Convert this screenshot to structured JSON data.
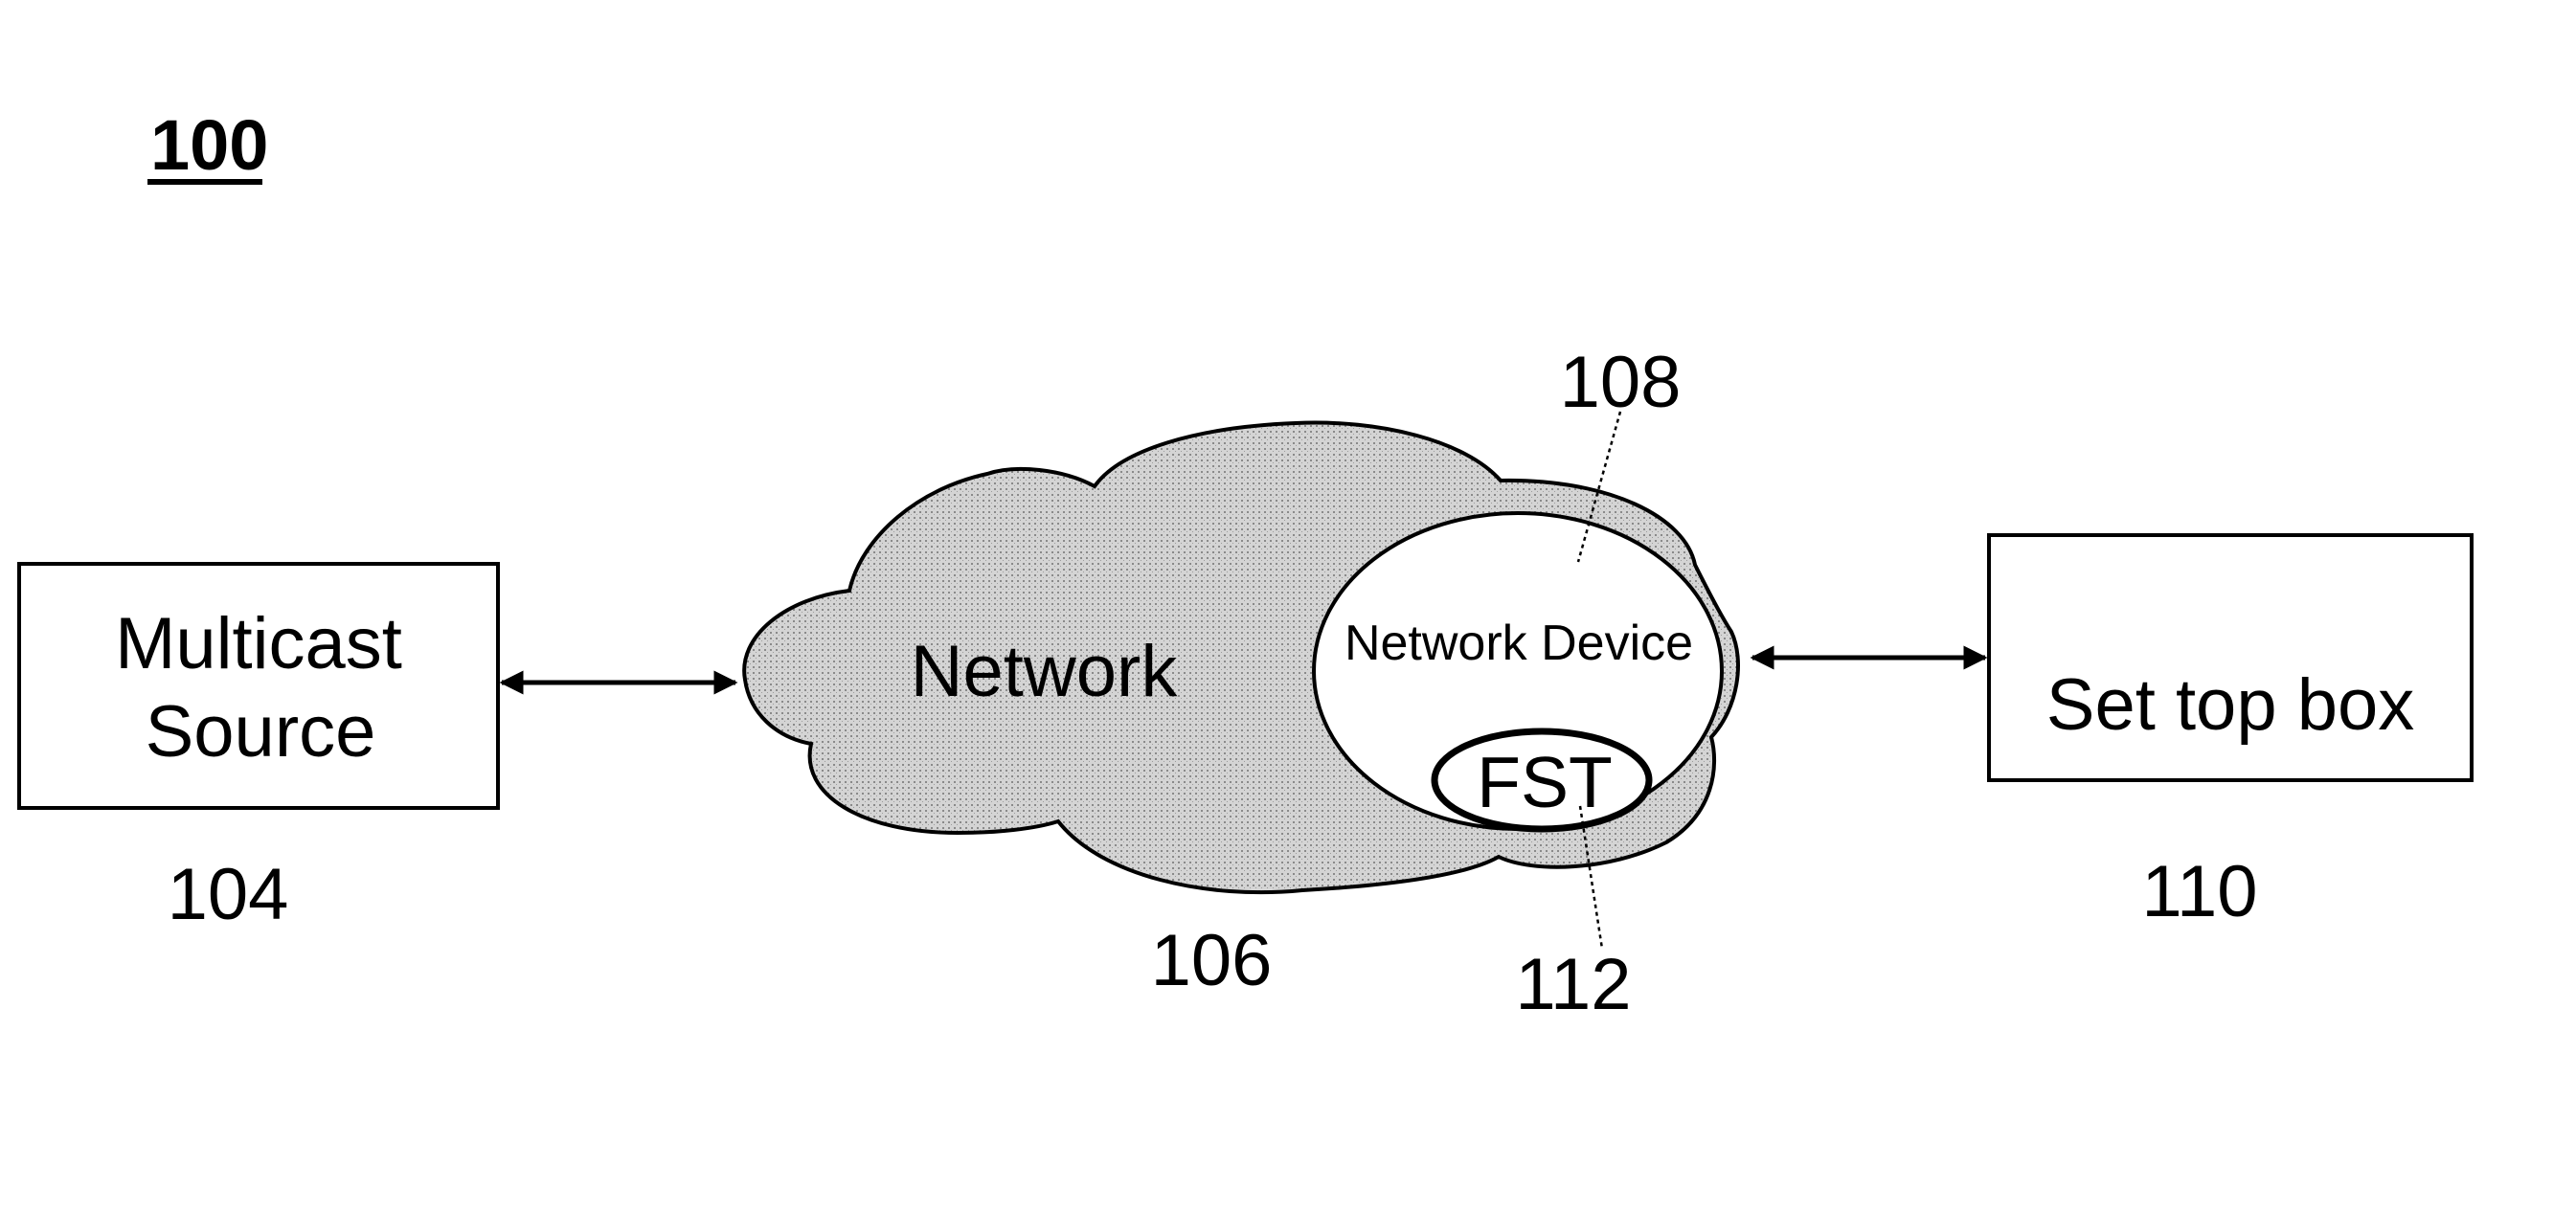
{
  "figure": {
    "number": "100"
  },
  "nodes": {
    "multicast_source": {
      "label_lines": [
        "Multicast",
        "Source"
      ],
      "ref": "104"
    },
    "network": {
      "label": "Network",
      "ref": "106"
    },
    "network_device": {
      "label": "Network Device",
      "ref": "108"
    },
    "set_top_box": {
      "label": "Set top box",
      "ref": "110"
    },
    "fst": {
      "label": "FST",
      "ref": "112"
    }
  },
  "connections": [
    {
      "from": "multicast_source",
      "to": "network",
      "type": "bidirectional-arrow"
    },
    {
      "from": "network_device",
      "to": "set_top_box",
      "type": "bidirectional-arrow"
    }
  ],
  "colors": {
    "ink": "#000000",
    "cloud_fill": "#c9c9c9",
    "background": "#ffffff"
  }
}
